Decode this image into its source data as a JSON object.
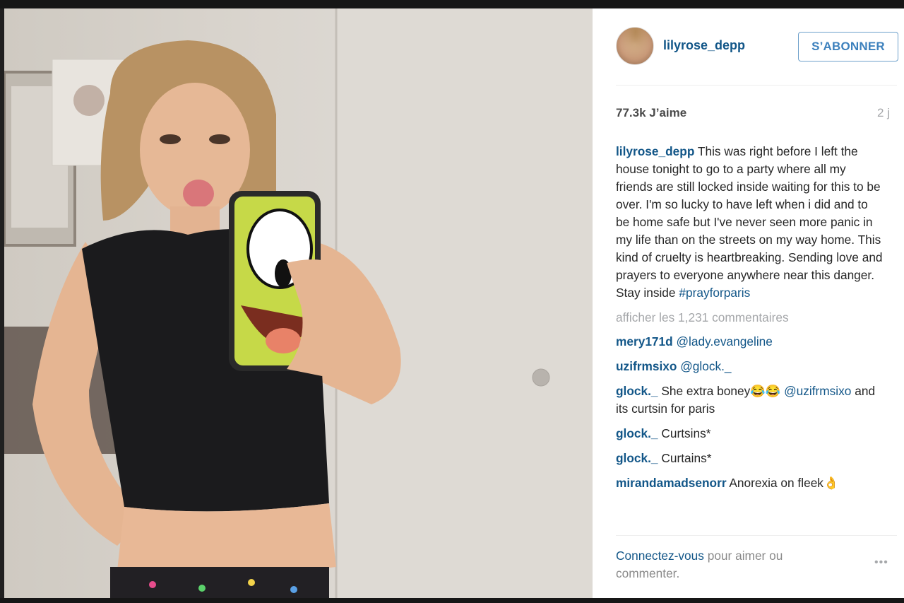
{
  "post": {
    "username": "lilyrose_depp",
    "follow_label": "S’ABONNER",
    "likes": "77.3k J’aime",
    "time": "2 j",
    "caption": "This was right before I left the house tonight to go to a party where all my friends are still locked inside waiting for this to be over. I'm so lucky to have left when i did and to be home safe but I've never seen more panic in my life than on the streets on my way home. This kind of cruelty is heartbreaking. Sending love and prayers to everyone anywhere near this danger. Stay inside",
    "hashtag": "#prayforparis",
    "view_comments": "afficher les 1,231 commentaires"
  },
  "comments": [
    {
      "user": "mery171d",
      "mention": "@lady.evangeline",
      "text": ""
    },
    {
      "user": "uzifrmsixo",
      "mention": "@glock._",
      "text": ""
    },
    {
      "user": "glock._",
      "text": "She extra boney😂😂",
      "mention": "@uzifrmsixo",
      "text2": "and its curtsin for paris"
    },
    {
      "user": "glock._",
      "text": "Curtsins*"
    },
    {
      "user": "glock._",
      "text": "Curtains*"
    },
    {
      "user": "mirandamadsenorr",
      "text": "Anorexia on fleek👌"
    }
  ],
  "footer": {
    "login_link": "Connectez-vous",
    "login_text": "pour aimer ou commenter.",
    "more_icon": "•••"
  },
  "icons": {
    "avatar": "profile-avatar",
    "more": "more-options-icon"
  },
  "colors": {
    "link": "#125688",
    "follow_border": "#6fa1cb",
    "muted": "#a5a7aa"
  }
}
